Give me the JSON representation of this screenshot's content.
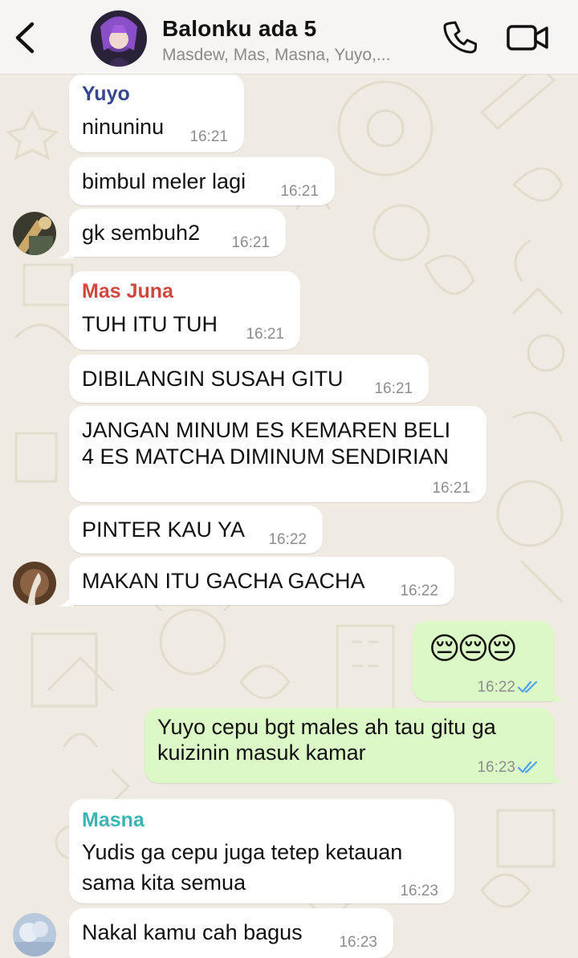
{
  "header": {
    "title": "Balonku ada 5",
    "members": "Masdew, Mas, Masna, Yuyo,...",
    "icons": {
      "back": "chevron-left-icon",
      "call": "phone-icon",
      "video": "video-camera-icon"
    }
  },
  "colors": {
    "outgoing_bubble": "#dbf8c6",
    "incoming_bubble": "#ffffff",
    "yuyo": "#35478f",
    "mas_juna": "#d2473d",
    "masna": "#3bb5b3",
    "read_tick": "#4fa3f0"
  },
  "messages": [
    {
      "sender": "Yuyo",
      "text": "ninuninu",
      "time": "16:21"
    },
    {
      "text": "bimbul meler lagi",
      "time": "16:21"
    },
    {
      "text": "gk sembuh2",
      "time": "16:21"
    },
    {
      "sender": "Mas Juna",
      "text": "TUH ITU TUH",
      "time": "16:21"
    },
    {
      "text": "DIBILANGIN SUSAH GITU",
      "time": "16:21"
    },
    {
      "lines": [
        "JANGAN MINUM ES KEMAREN BELI",
        "4 ES MATCHA DIMINUM SENDIRIAN"
      ],
      "time": "16:21"
    },
    {
      "text": "PINTER KAU YA",
      "time": "16:22"
    },
    {
      "text": "MAKAN ITU GACHA GACHA",
      "time": "16:22"
    },
    {
      "text": "😔😔😔",
      "time": "16:22",
      "status": "read"
    },
    {
      "lines": [
        "Yuyo cepu bgt males ah tau gitu ga",
        "kuizinin masuk kamar"
      ],
      "time": "16:23",
      "status": "read"
    },
    {
      "sender": "Masna",
      "lines": [
        "Yudis ga cepu juga tetep ketauan",
        "sama kita semua"
      ],
      "time": "16:23"
    },
    {
      "text": "Nakal kamu cah bagus",
      "time": "16:23"
    }
  ]
}
